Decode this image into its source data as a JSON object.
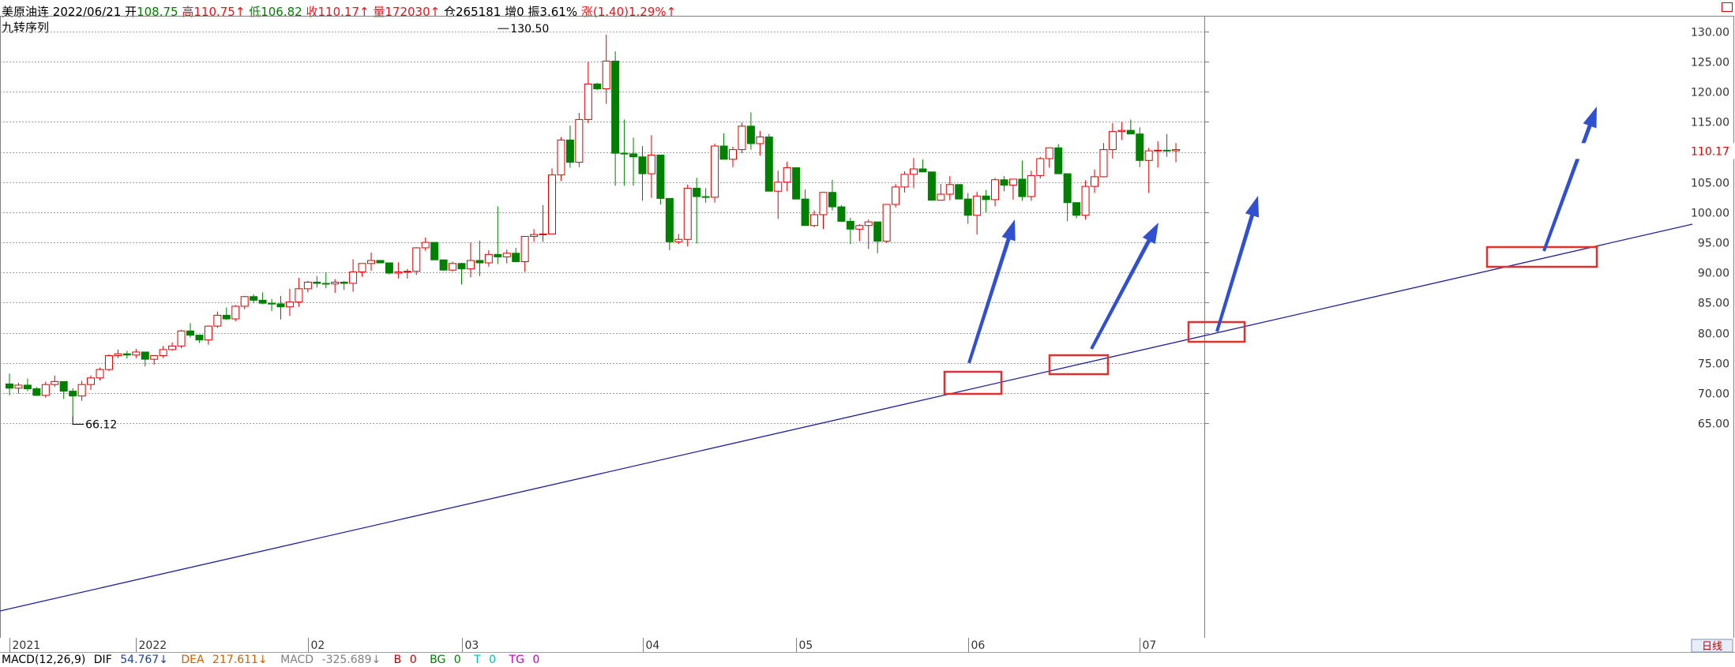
{
  "info_bar": {
    "name": "美原油连",
    "date": "2022/06/21",
    "open_label": "开",
    "open_value": "108.75",
    "high_label": "高",
    "high_value": "110.75↑",
    "low_label": "低",
    "low_value": "106.82",
    "close_label": "收",
    "close_value": "110.17↑",
    "volume_label": "量",
    "volume_value": "172030↑",
    "position_label": "仓",
    "position_value": "265181",
    "increase_label": "增",
    "increase_value": "0",
    "amplitude_label": "振",
    "amplitude_value": "3.61%",
    "change_label": "涨",
    "change_value": "(1.40)1.29%↑"
  },
  "indicator_name": "九转序列",
  "macd_bar": {
    "name": "MACD(12,26,9)",
    "dif_label": "DIF",
    "dif_value": "54.767↓",
    "dea_label": "DEA",
    "dea_value": "217.611↓",
    "macd_label": "MACD",
    "macd_value": "-325.689↓",
    "b_label": "B",
    "b_value": "0",
    "bg_label": "BG",
    "bg_value": "0",
    "t_label": "T",
    "t_value": "0",
    "tg_label": "TG",
    "tg_value": "0"
  },
  "chart_data": {
    "type": "candlestick",
    "period_label": "日线",
    "last_price_label": "110.17",
    "y_ticks": [
      "130.00",
      "125.00",
      "120.00",
      "115.00",
      "110.00",
      "105.00",
      "100.00",
      "95.00",
      "90.00",
      "85.00",
      "80.00",
      "75.00",
      "70.00",
      "65.00"
    ],
    "ylim": [
      62.5,
      132.5
    ],
    "x_tick_labels": [
      {
        "label": "2021",
        "index": 0
      },
      {
        "label": "2022",
        "index": 14
      },
      {
        "label": "02",
        "index": 33
      },
      {
        "label": "03",
        "index": 50
      },
      {
        "label": "04",
        "index": 70
      },
      {
        "label": "05",
        "index": 87
      },
      {
        "label": "06",
        "index": 106
      },
      {
        "label": "07",
        "index": 125
      }
    ],
    "x_count": 130,
    "annotations": [
      {
        "text": "130.50",
        "index": 54,
        "price": 130.5,
        "kind": "high"
      },
      {
        "text": "66.12",
        "index": 7,
        "price": 66.12,
        "kind": "low"
      }
    ],
    "candles": [
      [
        71.5,
        73.2,
        69.6,
        70.8
      ],
      [
        70.8,
        71.7,
        69.9,
        71.3
      ],
      [
        71.3,
        72.4,
        70.3,
        70.7
      ],
      [
        70.7,
        71.0,
        69.5,
        69.6
      ],
      [
        69.6,
        71.9,
        69.2,
        71.4
      ],
      [
        71.4,
        72.9,
        71.0,
        71.9
      ],
      [
        71.9,
        71.9,
        69.0,
        70.3
      ],
      [
        70.3,
        70.8,
        66.1,
        69.5
      ],
      [
        69.5,
        72.0,
        68.7,
        71.4
      ],
      [
        71.4,
        72.9,
        70.5,
        72.5
      ],
      [
        72.5,
        74.2,
        72.1,
        73.9
      ],
      [
        73.9,
        76.4,
        73.6,
        76.2
      ],
      [
        76.2,
        77.2,
        75.8,
        76.5
      ],
      [
        76.5,
        77.0,
        75.7,
        76.3
      ],
      [
        76.3,
        77.3,
        75.8,
        76.8
      ],
      [
        76.8,
        76.8,
        74.4,
        75.6
      ],
      [
        75.6,
        76.1,
        74.7,
        76.2
      ],
      [
        76.2,
        77.8,
        75.8,
        77.2
      ],
      [
        77.2,
        78.4,
        77.0,
        77.8
      ],
      [
        77.8,
        80.5,
        77.4,
        80.3
      ],
      [
        80.3,
        81.6,
        79.2,
        79.6
      ],
      [
        79.6,
        79.6,
        78.3,
        78.8
      ],
      [
        78.8,
        81.2,
        78.0,
        81.1
      ],
      [
        81.1,
        83.5,
        80.8,
        82.9
      ],
      [
        82.9,
        84.2,
        82.1,
        82.3
      ],
      [
        82.3,
        84.6,
        81.9,
        84.4
      ],
      [
        84.4,
        86.1,
        83.9,
        86.0
      ],
      [
        86.0,
        86.4,
        84.9,
        85.4
      ],
      [
        85.4,
        86.7,
        84.7,
        84.9
      ],
      [
        84.9,
        85.6,
        83.6,
        84.8
      ],
      [
        84.8,
        86.1,
        82.2,
        84.3
      ],
      [
        84.3,
        87.3,
        82.8,
        85.1
      ],
      [
        85.1,
        89.1,
        84.3,
        87.3
      ],
      [
        87.3,
        88.6,
        86.7,
        88.4
      ],
      [
        88.4,
        89.4,
        87.5,
        88.2
      ],
      [
        88.2,
        90.0,
        87.4,
        88.1
      ],
      [
        88.1,
        88.9,
        86.6,
        88.4
      ],
      [
        88.4,
        88.6,
        87.1,
        88.2
      ],
      [
        88.2,
        92.2,
        86.8,
        90.1
      ],
      [
        90.1,
        91.4,
        89.3,
        91.5
      ],
      [
        91.5,
        93.3,
        90.3,
        92.0
      ],
      [
        92.0,
        92.0,
        91.7,
        91.6
      ],
      [
        91.6,
        91.6,
        89.7,
        89.9
      ],
      [
        89.9,
        91.7,
        89.0,
        90.1
      ],
      [
        90.1,
        90.6,
        89.0,
        90.2
      ],
      [
        90.2,
        94.2,
        89.6,
        94.1
      ],
      [
        94.1,
        95.8,
        93.6,
        95.0
      ],
      [
        95.0,
        95.0,
        92.3,
        92.1
      ],
      [
        92.1,
        92.1,
        90.3,
        90.4
      ],
      [
        90.4,
        91.8,
        90.2,
        91.5
      ],
      [
        91.5,
        91.6,
        88.0,
        90.6
      ],
      [
        90.6,
        95.0,
        89.2,
        92.0
      ],
      [
        92.0,
        95.3,
        89.4,
        91.6
      ],
      [
        91.6,
        93.7,
        91.0,
        93.0
      ],
      [
        93.0,
        101.0,
        91.4,
        92.6
      ],
      [
        92.6,
        93.8,
        91.5,
        93.2
      ],
      [
        93.2,
        94.1,
        91.7,
        91.8
      ],
      [
        91.8,
        93.1,
        90.1,
        96.0
      ],
      [
        96.0,
        97.2,
        95.1,
        96.3
      ],
      [
        96.3,
        101.2,
        95.1,
        96.4
      ],
      [
        96.4,
        107.3,
        96.4,
        106.2
      ],
      [
        106.2,
        112.5,
        105.2,
        112.0
      ],
      [
        112.0,
        114.4,
        107.4,
        108.3
      ],
      [
        108.3,
        116.5,
        107.5,
        115.4
      ],
      [
        115.4,
        125.0,
        114.8,
        121.3
      ],
      [
        121.3,
        121.5,
        120.3,
        120.5
      ],
      [
        120.5,
        129.5,
        118.0,
        125.1
      ],
      [
        125.1,
        126.7,
        104.4,
        109.8
      ],
      [
        109.8,
        115.4,
        104.4,
        109.7
      ],
      [
        109.7,
        112.4,
        104.4,
        109.2
      ],
      [
        109.2,
        111.0,
        101.9,
        106.4
      ],
      [
        106.4,
        112.8,
        102.4,
        109.5
      ],
      [
        109.5,
        109.5,
        101.3,
        102.3
      ],
      [
        102.3,
        102.3,
        93.7,
        95.1
      ],
      [
        95.1,
        96.4,
        94.7,
        95.5
      ],
      [
        95.5,
        104.6,
        94.3,
        104.0
      ],
      [
        104.0,
        105.7,
        94.8,
        102.6
      ],
      [
        102.6,
        104.0,
        101.6,
        102.5
      ],
      [
        102.5,
        111.4,
        101.6,
        111.0
      ],
      [
        111.0,
        113.1,
        108.8,
        108.8
      ],
      [
        108.8,
        110.9,
        107.5,
        110.4
      ],
      [
        110.4,
        114.9,
        109.8,
        114.3
      ],
      [
        114.3,
        116.6,
        110.4,
        111.4
      ],
      [
        111.4,
        113.5,
        109.4,
        112.5
      ],
      [
        112.5,
        113.0,
        104.3,
        103.5
      ],
      [
        103.5,
        106.9,
        98.9,
        105.0
      ],
      [
        105.0,
        108.4,
        103.5,
        107.4
      ],
      [
        107.4,
        107.4,
        104.3,
        102.2
      ],
      [
        102.2,
        103.8,
        98.8,
        97.8
      ],
      [
        97.8,
        100.3,
        97.5,
        99.6
      ],
      [
        99.6,
        102.9,
        97.2,
        103.3
      ],
      [
        103.3,
        105.4,
        100.3,
        100.9
      ],
      [
        100.9,
        101.2,
        98.4,
        98.5
      ],
      [
        98.5,
        99.1,
        94.7,
        97.2
      ],
      [
        97.2,
        98.0,
        95.2,
        97.8
      ],
      [
        97.8,
        98.8,
        93.9,
        98.4
      ],
      [
        98.4,
        98.4,
        93.2,
        95.2
      ],
      [
        95.2,
        101.3,
        94.9,
        101.3
      ],
      [
        101.3,
        104.7,
        100.8,
        104.2
      ],
      [
        104.2,
        106.8,
        103.3,
        106.3
      ],
      [
        106.3,
        109.0,
        104.0,
        107.2
      ],
      [
        107.2,
        108.8,
        106.8,
        106.7
      ],
      [
        106.7,
        106.7,
        103.1,
        102.0
      ],
      [
        102.0,
        104.7,
        101.9,
        103.0
      ],
      [
        103.0,
        106.0,
        102.0,
        104.6
      ],
      [
        104.6,
        104.6,
        102.6,
        102.2
      ],
      [
        102.2,
        103.2,
        98.1,
        99.5
      ],
      [
        99.5,
        103.4,
        96.3,
        102.7
      ],
      [
        102.7,
        103.7,
        100.0,
        102.1
      ],
      [
        102.1,
        105.7,
        101.0,
        105.4
      ],
      [
        105.4,
        106.0,
        103.5,
        104.5
      ],
      [
        104.5,
        105.4,
        102.1,
        105.5
      ],
      [
        105.5,
        108.6,
        101.9,
        102.6
      ],
      [
        102.6,
        106.9,
        101.9,
        106.1
      ],
      [
        106.1,
        109.2,
        105.6,
        108.9
      ],
      [
        108.9,
        110.0,
        107.4,
        110.7
      ],
      [
        110.7,
        111.3,
        109.2,
        106.4
      ],
      [
        106.4,
        106.4,
        98.5,
        101.6
      ],
      [
        101.6,
        101.6,
        99.0,
        99.5
      ],
      [
        99.5,
        105.3,
        98.8,
        104.3
      ],
      [
        104.3,
        107.1,
        103.2,
        105.9
      ],
      [
        105.9,
        111.5,
        105.8,
        110.4
      ],
      [
        110.4,
        114.8,
        108.9,
        113.4
      ],
      [
        113.4,
        115.0,
        112.0,
        113.6
      ],
      [
        113.6,
        115.4,
        113.5,
        113.0
      ],
      [
        113.0,
        114.1,
        107.5,
        108.6
      ],
      [
        108.6,
        110.7,
        103.2,
        110.2
      ],
      [
        110.2,
        111.8,
        107.4,
        110.3
      ],
      [
        110.3,
        113.0,
        109.2,
        110.2
      ],
      [
        110.2,
        111.5,
        108.3,
        110.4
      ]
    ]
  }
}
